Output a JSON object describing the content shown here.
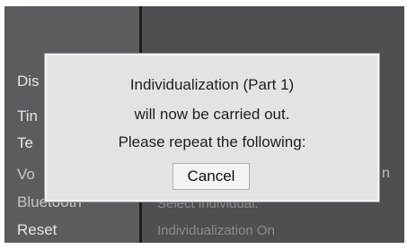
{
  "menu": {
    "items": [
      "Dis",
      "Tin",
      "Te",
      "Vo",
      "Bluetooth",
      "Reset"
    ]
  },
  "right_panel": {
    "items": [
      "Select individual.",
      "Individualization On"
    ],
    "edge_text": "n"
  },
  "dialog": {
    "line1": "Individualization (Part 1)",
    "line2": "will now be carried out.",
    "line3": "Please repeat the following:",
    "cancel_label": "Cancel"
  }
}
